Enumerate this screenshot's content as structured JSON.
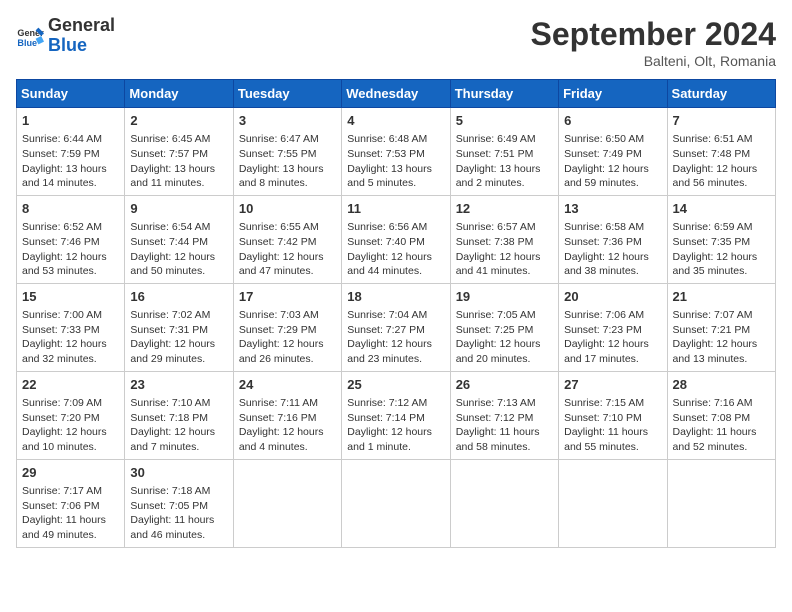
{
  "header": {
    "logo_general": "General",
    "logo_blue": "Blue",
    "month_title": "September 2024",
    "location": "Balteni, Olt, Romania"
  },
  "days_of_week": [
    "Sunday",
    "Monday",
    "Tuesday",
    "Wednesday",
    "Thursday",
    "Friday",
    "Saturday"
  ],
  "weeks": [
    [
      {
        "day": 1,
        "info": "Sunrise: 6:44 AM\nSunset: 7:59 PM\nDaylight: 13 hours and 14 minutes."
      },
      {
        "day": 2,
        "info": "Sunrise: 6:45 AM\nSunset: 7:57 PM\nDaylight: 13 hours and 11 minutes."
      },
      {
        "day": 3,
        "info": "Sunrise: 6:47 AM\nSunset: 7:55 PM\nDaylight: 13 hours and 8 minutes."
      },
      {
        "day": 4,
        "info": "Sunrise: 6:48 AM\nSunset: 7:53 PM\nDaylight: 13 hours and 5 minutes."
      },
      {
        "day": 5,
        "info": "Sunrise: 6:49 AM\nSunset: 7:51 PM\nDaylight: 13 hours and 2 minutes."
      },
      {
        "day": 6,
        "info": "Sunrise: 6:50 AM\nSunset: 7:49 PM\nDaylight: 12 hours and 59 minutes."
      },
      {
        "day": 7,
        "info": "Sunrise: 6:51 AM\nSunset: 7:48 PM\nDaylight: 12 hours and 56 minutes."
      }
    ],
    [
      {
        "day": 8,
        "info": "Sunrise: 6:52 AM\nSunset: 7:46 PM\nDaylight: 12 hours and 53 minutes."
      },
      {
        "day": 9,
        "info": "Sunrise: 6:54 AM\nSunset: 7:44 PM\nDaylight: 12 hours and 50 minutes."
      },
      {
        "day": 10,
        "info": "Sunrise: 6:55 AM\nSunset: 7:42 PM\nDaylight: 12 hours and 47 minutes."
      },
      {
        "day": 11,
        "info": "Sunrise: 6:56 AM\nSunset: 7:40 PM\nDaylight: 12 hours and 44 minutes."
      },
      {
        "day": 12,
        "info": "Sunrise: 6:57 AM\nSunset: 7:38 PM\nDaylight: 12 hours and 41 minutes."
      },
      {
        "day": 13,
        "info": "Sunrise: 6:58 AM\nSunset: 7:36 PM\nDaylight: 12 hours and 38 minutes."
      },
      {
        "day": 14,
        "info": "Sunrise: 6:59 AM\nSunset: 7:35 PM\nDaylight: 12 hours and 35 minutes."
      }
    ],
    [
      {
        "day": 15,
        "info": "Sunrise: 7:00 AM\nSunset: 7:33 PM\nDaylight: 12 hours and 32 minutes."
      },
      {
        "day": 16,
        "info": "Sunrise: 7:02 AM\nSunset: 7:31 PM\nDaylight: 12 hours and 29 minutes."
      },
      {
        "day": 17,
        "info": "Sunrise: 7:03 AM\nSunset: 7:29 PM\nDaylight: 12 hours and 26 minutes."
      },
      {
        "day": 18,
        "info": "Sunrise: 7:04 AM\nSunset: 7:27 PM\nDaylight: 12 hours and 23 minutes."
      },
      {
        "day": 19,
        "info": "Sunrise: 7:05 AM\nSunset: 7:25 PM\nDaylight: 12 hours and 20 minutes."
      },
      {
        "day": 20,
        "info": "Sunrise: 7:06 AM\nSunset: 7:23 PM\nDaylight: 12 hours and 17 minutes."
      },
      {
        "day": 21,
        "info": "Sunrise: 7:07 AM\nSunset: 7:21 PM\nDaylight: 12 hours and 13 minutes."
      }
    ],
    [
      {
        "day": 22,
        "info": "Sunrise: 7:09 AM\nSunset: 7:20 PM\nDaylight: 12 hours and 10 minutes."
      },
      {
        "day": 23,
        "info": "Sunrise: 7:10 AM\nSunset: 7:18 PM\nDaylight: 12 hours and 7 minutes."
      },
      {
        "day": 24,
        "info": "Sunrise: 7:11 AM\nSunset: 7:16 PM\nDaylight: 12 hours and 4 minutes."
      },
      {
        "day": 25,
        "info": "Sunrise: 7:12 AM\nSunset: 7:14 PM\nDaylight: 12 hours and 1 minute."
      },
      {
        "day": 26,
        "info": "Sunrise: 7:13 AM\nSunset: 7:12 PM\nDaylight: 11 hours and 58 minutes."
      },
      {
        "day": 27,
        "info": "Sunrise: 7:15 AM\nSunset: 7:10 PM\nDaylight: 11 hours and 55 minutes."
      },
      {
        "day": 28,
        "info": "Sunrise: 7:16 AM\nSunset: 7:08 PM\nDaylight: 11 hours and 52 minutes."
      }
    ],
    [
      {
        "day": 29,
        "info": "Sunrise: 7:17 AM\nSunset: 7:06 PM\nDaylight: 11 hours and 49 minutes."
      },
      {
        "day": 30,
        "info": "Sunrise: 7:18 AM\nSunset: 7:05 PM\nDaylight: 11 hours and 46 minutes."
      },
      {
        "day": null,
        "info": ""
      },
      {
        "day": null,
        "info": ""
      },
      {
        "day": null,
        "info": ""
      },
      {
        "day": null,
        "info": ""
      },
      {
        "day": null,
        "info": ""
      }
    ]
  ]
}
